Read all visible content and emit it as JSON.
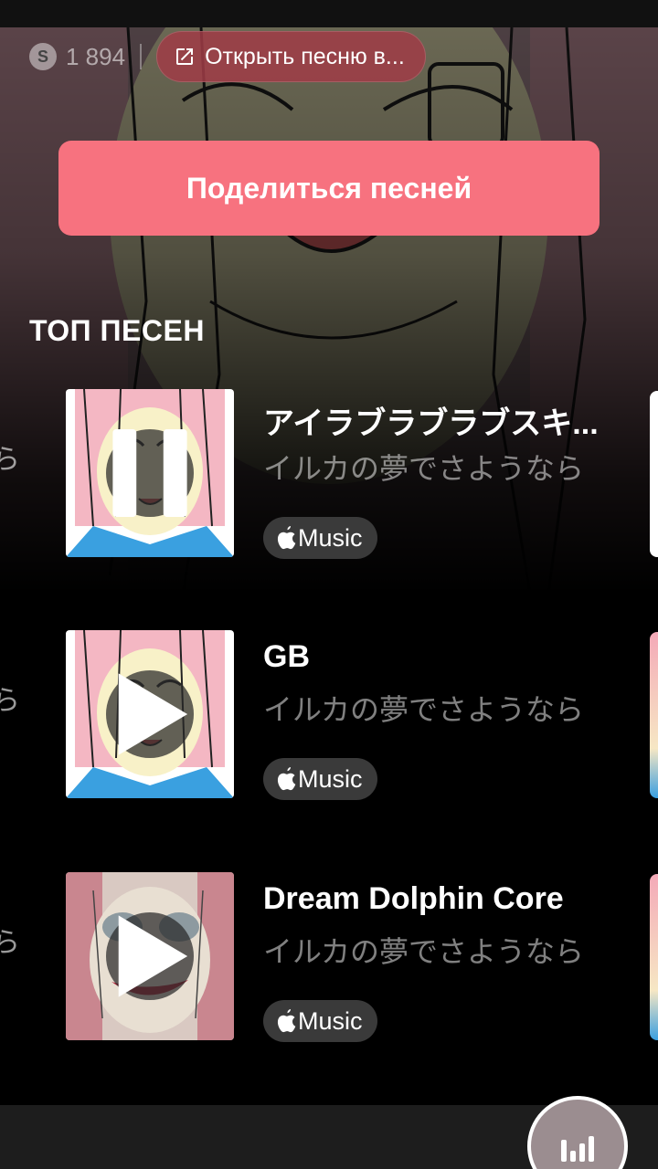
{
  "header": {
    "shazam_count": "1 894",
    "open_button_label": "Открыть песню в...",
    "share_button_label": "Поделиться песней"
  },
  "top_songs": {
    "title": "ТОП ПЕСЕН",
    "items": [
      {
        "title": "アイラブラブラブスキ...",
        "artist": "イルカの夢でさようなら",
        "badge": "Music",
        "state": "playing"
      },
      {
        "title": "GB",
        "artist": "イルカの夢でさようなら",
        "badge": "Music",
        "state": "paused"
      },
      {
        "title": "Dream Dolphin Core",
        "artist": "イルカの夢でさようなら",
        "badge": "Music",
        "state": "paused"
      }
    ]
  },
  "icons": {
    "shazam": "shazam-icon",
    "open_external": "open-external-icon",
    "pause": "pause-icon",
    "play": "play-icon",
    "apple": "apple-icon",
    "equalizer": "equalizer-icon"
  },
  "colors": {
    "share_button": "#f7727f",
    "open_button": "#a03c46",
    "badge": "#3a3a3a"
  }
}
